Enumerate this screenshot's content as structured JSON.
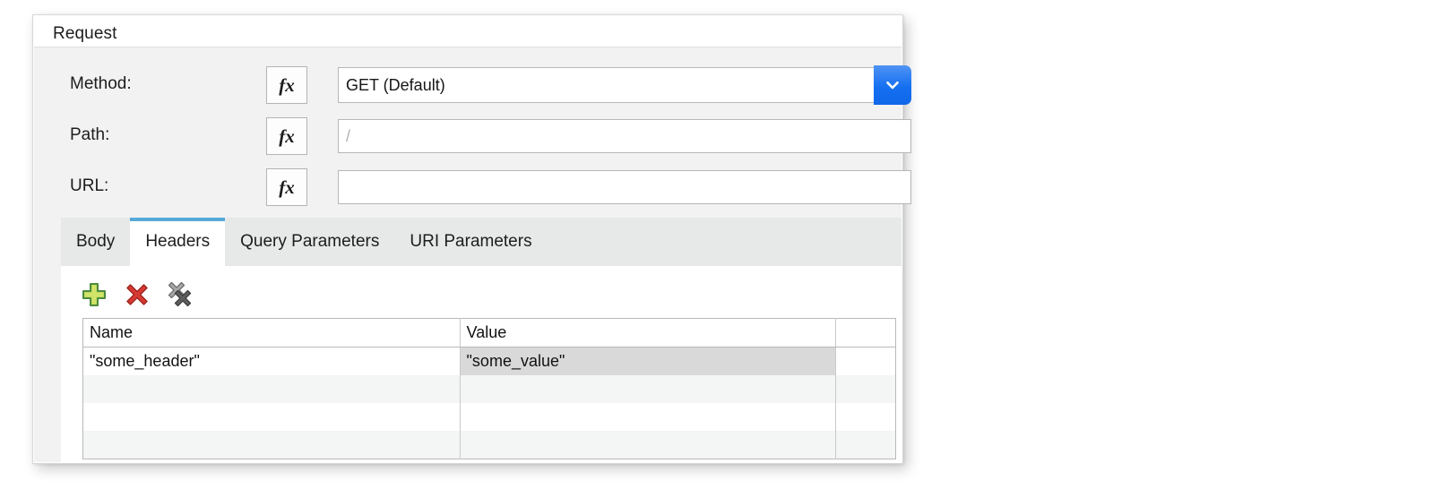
{
  "panel": {
    "title": "Request"
  },
  "form": {
    "rows": [
      {
        "label": "Method:",
        "fx_label": "fx",
        "value": "GET (Default)",
        "placeholder": "",
        "has_dropdown": true
      },
      {
        "label": "Path:",
        "fx_label": "fx",
        "value": "",
        "placeholder": "/",
        "has_dropdown": false
      },
      {
        "label": "URL:",
        "fx_label": "fx",
        "value": "",
        "placeholder": "",
        "has_dropdown": false
      }
    ]
  },
  "tabs": [
    {
      "label": "Body",
      "active": false
    },
    {
      "label": "Headers",
      "active": true
    },
    {
      "label": "Query Parameters",
      "active": false
    },
    {
      "label": "URI Parameters",
      "active": false
    }
  ],
  "toolbar": {
    "icons": [
      {
        "name": "add-icon",
        "title": "Add"
      },
      {
        "name": "delete-icon",
        "title": "Delete"
      },
      {
        "name": "delete-all-icon",
        "title": "Delete All"
      }
    ]
  },
  "headers_table": {
    "columns": [
      "Name",
      "Value",
      ""
    ],
    "rows": [
      {
        "name": "\"some_header\"",
        "value": "\"some_value\"",
        "extra": "",
        "value_selected": true
      },
      {
        "name": "",
        "value": "",
        "extra": "",
        "value_selected": false
      },
      {
        "name": "",
        "value": "",
        "extra": "",
        "value_selected": false
      },
      {
        "name": "",
        "value": "",
        "extra": "",
        "value_selected": false
      }
    ]
  },
  "colors": {
    "accent_blue": "#1570f0",
    "tab_indicator": "#56aad8",
    "panel_bg": "#f2f2f2",
    "tabstrip_bg": "#e7e8e8",
    "selection_gray": "#d9d9d9",
    "stripe_gray": "#f4f5f5",
    "add_green": "#8cc63f",
    "delete_red": "#d43f3a",
    "delete_all_gray": "#808080"
  }
}
